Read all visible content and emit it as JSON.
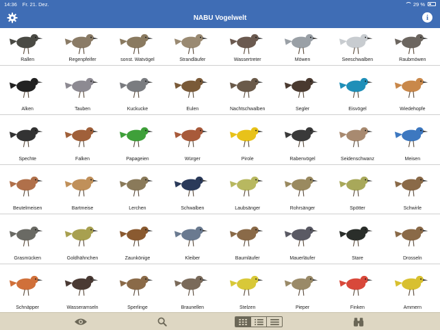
{
  "status": {
    "time": "14:36",
    "date": "Fr. 21. Dez.",
    "battery": "29 %"
  },
  "header": {
    "title": "NABU Vogelwelt"
  },
  "birds": [
    {
      "label": "Rallen",
      "color": "#4a4a44"
    },
    {
      "label": "Regenpfeifer",
      "color": "#8a7b66"
    },
    {
      "label": "sonst. Watvögel",
      "color": "#8a7a60"
    },
    {
      "label": "Strandläufer",
      "color": "#9a8a72"
    },
    {
      "label": "Wassertreter",
      "color": "#6b5a50"
    },
    {
      "label": "Möwen",
      "color": "#9aa0a6"
    },
    {
      "label": "Seeschwalben",
      "color": "#c8ccd0"
    },
    {
      "label": "Raubmöwen",
      "color": "#6c6660"
    },
    {
      "label": "Alken",
      "color": "#222222"
    },
    {
      "label": "Tauben",
      "color": "#8d8a92"
    },
    {
      "label": "Kuckucke",
      "color": "#7a7c80"
    },
    {
      "label": "Eulen",
      "color": "#7a5a38"
    },
    {
      "label": "Nachtschwalben",
      "color": "#6a5a4a"
    },
    {
      "label": "Segler",
      "color": "#4a3a30"
    },
    {
      "label": "Eisvögel",
      "color": "#1f8fb8"
    },
    {
      "label": "Wiedehopfe",
      "color": "#c9884a"
    },
    {
      "label": "Spechte",
      "color": "#333333"
    },
    {
      "label": "Falken",
      "color": "#a0603a"
    },
    {
      "label": "Papageien",
      "color": "#3fa03a"
    },
    {
      "label": "Würger",
      "color": "#a85a3a"
    },
    {
      "label": "Pirole",
      "color": "#e8c21a"
    },
    {
      "label": "Rabenvögel",
      "color": "#3a3a3a"
    },
    {
      "label": "Seidenschwanz",
      "color": "#a88a70"
    },
    {
      "label": "Meisen",
      "color": "#3d78c0"
    },
    {
      "label": "Beutelmeisen",
      "color": "#b0704a"
    },
    {
      "label": "Bartmeise",
      "color": "#c0905a"
    },
    {
      "label": "Lerchen",
      "color": "#8a7a5a"
    },
    {
      "label": "Schwalben",
      "color": "#2a3a5a"
    },
    {
      "label": "Laubsänger",
      "color": "#b8b860"
    },
    {
      "label": "Rohrsänger",
      "color": "#9a8a60"
    },
    {
      "label": "Spötter",
      "color": "#a8a85a"
    },
    {
      "label": "Schwirle",
      "color": "#8a6a48"
    },
    {
      "label": "Grasmücken",
      "color": "#6a6a64"
    },
    {
      "label": "Goldhähnchen",
      "color": "#a8a050"
    },
    {
      "label": "Zaunkönige",
      "color": "#8a5a30"
    },
    {
      "label": "Kleiber",
      "color": "#6a7a90"
    },
    {
      "label": "Baumläufer",
      "color": "#8a6a48"
    },
    {
      "label": "Mauerläufer",
      "color": "#5a5a64"
    },
    {
      "label": "Stare",
      "color": "#2a2e2a"
    },
    {
      "label": "Drosseln",
      "color": "#8a6a48"
    },
    {
      "label": "Schnäpper",
      "color": "#d0703a"
    },
    {
      "label": "Wasseramseln",
      "color": "#4a3a34"
    },
    {
      "label": "Sperlinge",
      "color": "#8a6a48"
    },
    {
      "label": "Braunellen",
      "color": "#7a6a5a"
    },
    {
      "label": "Stelzen",
      "color": "#d8c838"
    },
    {
      "label": "Pieper",
      "color": "#9a8a68"
    },
    {
      "label": "Finken",
      "color": "#d8483a"
    },
    {
      "label": "Ammern",
      "color": "#d8c030"
    }
  ],
  "toolbar": {
    "icons": [
      "eye-icon",
      "search-icon",
      "grid-view-icon",
      "list-view-icon",
      "compact-list-icon",
      "binoculars-icon"
    ]
  }
}
